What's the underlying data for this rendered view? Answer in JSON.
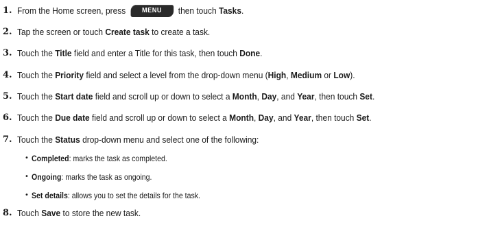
{
  "steps": [
    {
      "num": "1.",
      "parts": [
        {
          "t": "From the Home screen, press "
        },
        {
          "key": "MENU"
        },
        {
          "t": " then touch "
        },
        {
          "t": "Tasks",
          "b": true
        },
        {
          "t": "."
        }
      ]
    },
    {
      "num": "2.",
      "parts": [
        {
          "t": "Tap the screen or touch "
        },
        {
          "t": "Create task",
          "b": true
        },
        {
          "t": " to create a task."
        }
      ]
    },
    {
      "num": "3.",
      "parts": [
        {
          "t": "Touch the "
        },
        {
          "t": "Title",
          "b": true
        },
        {
          "t": " field and enter a Title for this task, then touch "
        },
        {
          "t": "Done",
          "b": true
        },
        {
          "t": "."
        }
      ]
    },
    {
      "num": "4.",
      "parts": [
        {
          "t": "Touch the "
        },
        {
          "t": "Priority",
          "b": true
        },
        {
          "t": " field and select a level from the drop-down menu ("
        },
        {
          "t": "High",
          "b": true
        },
        {
          "t": ", "
        },
        {
          "t": "Medium",
          "b": true
        },
        {
          "t": " or "
        },
        {
          "t": "Low",
          "b": true
        },
        {
          "t": ")."
        }
      ]
    },
    {
      "num": "5.",
      "parts": [
        {
          "t": "Touch the "
        },
        {
          "t": "Start date",
          "b": true
        },
        {
          "t": " field and scroll up or down to select a "
        },
        {
          "t": "Month",
          "b": true
        },
        {
          "t": ", "
        },
        {
          "t": "Day",
          "b": true
        },
        {
          "t": ", and "
        },
        {
          "t": "Year",
          "b": true
        },
        {
          "t": ", then touch "
        },
        {
          "t": "Set",
          "b": true
        },
        {
          "t": "."
        }
      ]
    },
    {
      "num": "6.",
      "parts": [
        {
          "t": "Touch the "
        },
        {
          "t": "Due date",
          "b": true
        },
        {
          "t": " field and scroll up or down to select a "
        },
        {
          "t": "Month",
          "b": true
        },
        {
          "t": ", "
        },
        {
          "t": "Day",
          "b": true
        },
        {
          "t": ", and "
        },
        {
          "t": "Year",
          "b": true
        },
        {
          "t": ", then touch "
        },
        {
          "t": "Set",
          "b": true
        },
        {
          "t": "."
        }
      ]
    },
    {
      "num": "7.",
      "parts": [
        {
          "t": "Touch the "
        },
        {
          "t": "Status",
          "b": true
        },
        {
          "t": " drop-down menu and select one of the following:"
        }
      ]
    },
    {
      "num": "8.",
      "parts": [
        {
          "t": "Touch "
        },
        {
          "t": "Save",
          "b": true
        },
        {
          "t": " to store the new task."
        }
      ]
    }
  ],
  "status_options": [
    {
      "bullet": "•",
      "term": "Completed",
      "desc": ": marks the task as completed."
    },
    {
      "bullet": "•",
      "term": "Ongoing",
      "desc": ": marks the task as ongoing."
    },
    {
      "bullet": "•",
      "term": "Set details",
      "desc": ": allows you to set the details for the task."
    }
  ]
}
